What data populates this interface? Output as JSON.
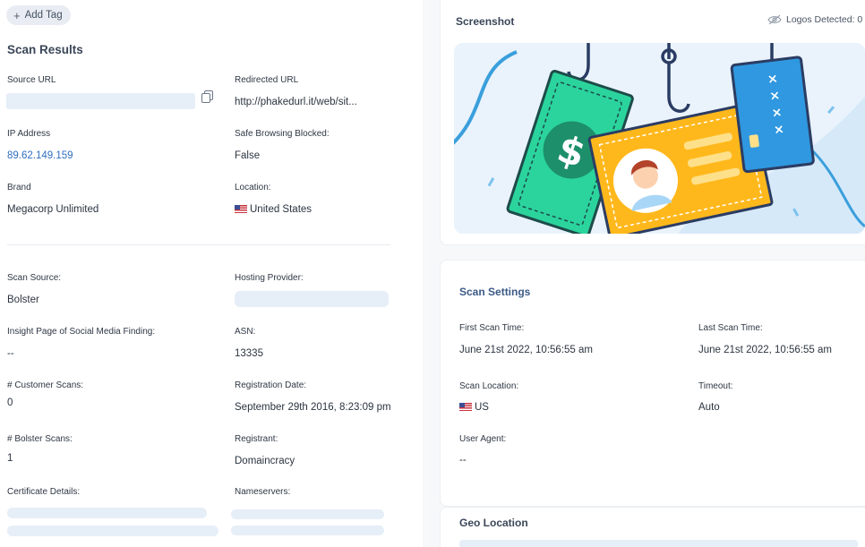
{
  "tag_button": {
    "label": "Add Tag"
  },
  "scan_results": {
    "title": "Scan Results",
    "source_url": {
      "label": "Source URL"
    },
    "redirected_url": {
      "label": "Redirected URL",
      "value": "http://phakedurl.it/web/sit..."
    },
    "ip_address": {
      "label": "IP Address",
      "value": "89.62.149.159"
    },
    "safe_browsing": {
      "label": "Safe Browsing Blocked:",
      "value": "False"
    },
    "brand": {
      "label": "Brand",
      "value": "Megacorp Unlimited"
    },
    "location": {
      "label": "Location:",
      "value": "United States"
    },
    "scan_source": {
      "label": "Scan Source:",
      "value": "Bolster"
    },
    "hosting_provider": {
      "label": "Hosting Provider:"
    },
    "insight_page": {
      "label": "Insight Page of Social Media Finding:",
      "value": "--"
    },
    "asn": {
      "label": "ASN:",
      "value": "13335"
    },
    "customer_scans": {
      "label": "# Customer Scans:",
      "value": "0"
    },
    "registration_date": {
      "label": "Registration Date:",
      "value": "September 29th 2016, 8:23:09 pm"
    },
    "bolster_scans": {
      "label": "# Bolster Scans:",
      "value": "1"
    },
    "registrant": {
      "label": "Registrant:",
      "value": "Domaincracy"
    },
    "certificate": {
      "label": "Certificate Details:"
    },
    "nameservers": {
      "label": "Nameservers:"
    }
  },
  "screenshot": {
    "title": "Screenshot",
    "logos_detected": "Logos Detected: 0",
    "illustration_symbol": "$",
    "card_marks": [
      "×",
      "×",
      "×",
      "×"
    ]
  },
  "scan_settings": {
    "title": "Scan Settings",
    "first_scan": {
      "label": "First Scan Time:",
      "value": "June 21st 2022, 10:56:55 am"
    },
    "last_scan": {
      "label": "Last Scan Time:",
      "value": "June 21st 2022, 10:56:55 am"
    },
    "scan_location": {
      "label": "Scan Location:",
      "value": "US"
    },
    "timeout": {
      "label": "Timeout:",
      "value": "Auto"
    },
    "user_agent": {
      "label": "User Agent:",
      "value": "--"
    }
  },
  "geo_location": {
    "title": "Geo Location"
  },
  "icons": [
    "plus-icon",
    "copy-icon",
    "us-flag-icon",
    "eye-slash-icon"
  ],
  "colors": {
    "link": "#2f6fc0",
    "skeleton": "#e6eef8",
    "title": "#3a4658"
  }
}
